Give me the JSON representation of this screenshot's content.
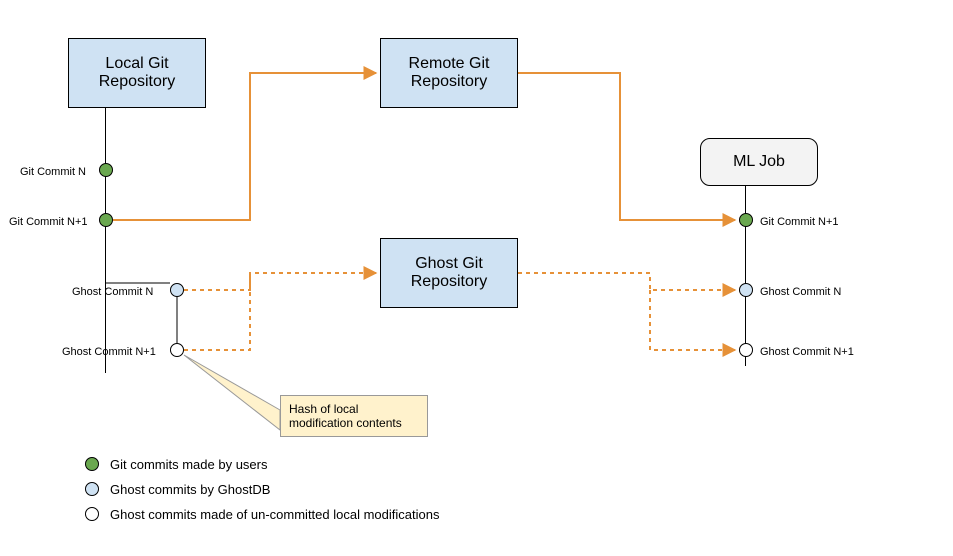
{
  "boxes": {
    "local_repo": "Local Git\nRepository",
    "remote_repo": "Remote Git\nRepository",
    "ghost_repo": "Ghost Git\nRepository",
    "ml_job": "ML Job"
  },
  "commits": {
    "git_commit_n": "Git Commit N",
    "git_commit_n1": "Git Commit N+1",
    "ghost_commit_n": "Ghost Commit N",
    "ghost_commit_n1": "Ghost Commit N+1",
    "ml_git_commit_n1": "Git Commit N+1",
    "ml_ghost_commit_n": "Ghost Commit N",
    "ml_ghost_commit_n1": "Ghost Commit N+1"
  },
  "callout": "Hash of local modification contents",
  "legend": {
    "l1": "Git commits made by users",
    "l2": "Ghost commits by GhostDB",
    "l3": "Ghost commits made of un-committed local modifications"
  }
}
